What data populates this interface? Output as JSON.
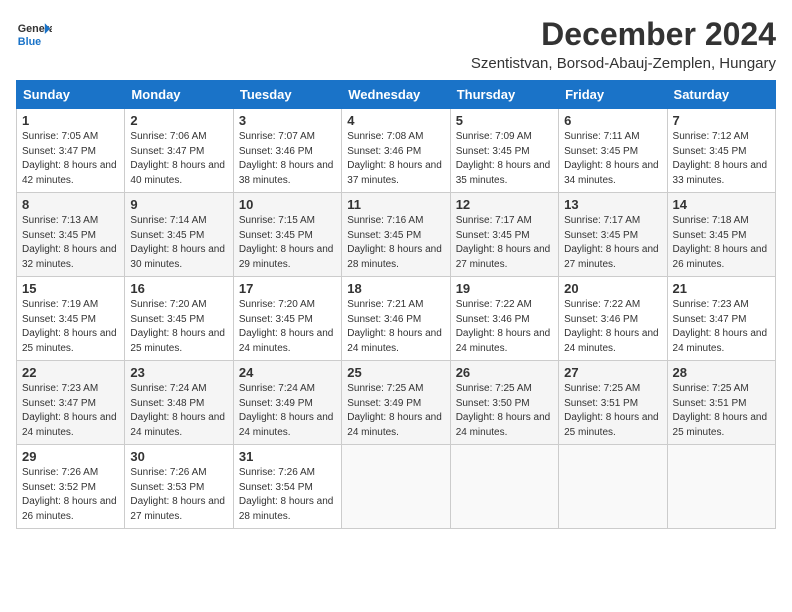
{
  "header": {
    "logo_line1": "General",
    "logo_line2": "Blue",
    "month_title": "December 2024",
    "location": "Szentistvan, Borsod-Abauj-Zemplen, Hungary"
  },
  "weekdays": [
    "Sunday",
    "Monday",
    "Tuesday",
    "Wednesday",
    "Thursday",
    "Friday",
    "Saturday"
  ],
  "weeks": [
    [
      {
        "day": "1",
        "sunrise": "Sunrise: 7:05 AM",
        "sunset": "Sunset: 3:47 PM",
        "daylight": "Daylight: 8 hours and 42 minutes."
      },
      {
        "day": "2",
        "sunrise": "Sunrise: 7:06 AM",
        "sunset": "Sunset: 3:47 PM",
        "daylight": "Daylight: 8 hours and 40 minutes."
      },
      {
        "day": "3",
        "sunrise": "Sunrise: 7:07 AM",
        "sunset": "Sunset: 3:46 PM",
        "daylight": "Daylight: 8 hours and 38 minutes."
      },
      {
        "day": "4",
        "sunrise": "Sunrise: 7:08 AM",
        "sunset": "Sunset: 3:46 PM",
        "daylight": "Daylight: 8 hours and 37 minutes."
      },
      {
        "day": "5",
        "sunrise": "Sunrise: 7:09 AM",
        "sunset": "Sunset: 3:45 PM",
        "daylight": "Daylight: 8 hours and 35 minutes."
      },
      {
        "day": "6",
        "sunrise": "Sunrise: 7:11 AM",
        "sunset": "Sunset: 3:45 PM",
        "daylight": "Daylight: 8 hours and 34 minutes."
      },
      {
        "day": "7",
        "sunrise": "Sunrise: 7:12 AM",
        "sunset": "Sunset: 3:45 PM",
        "daylight": "Daylight: 8 hours and 33 minutes."
      }
    ],
    [
      {
        "day": "8",
        "sunrise": "Sunrise: 7:13 AM",
        "sunset": "Sunset: 3:45 PM",
        "daylight": "Daylight: 8 hours and 32 minutes."
      },
      {
        "day": "9",
        "sunrise": "Sunrise: 7:14 AM",
        "sunset": "Sunset: 3:45 PM",
        "daylight": "Daylight: 8 hours and 30 minutes."
      },
      {
        "day": "10",
        "sunrise": "Sunrise: 7:15 AM",
        "sunset": "Sunset: 3:45 PM",
        "daylight": "Daylight: 8 hours and 29 minutes."
      },
      {
        "day": "11",
        "sunrise": "Sunrise: 7:16 AM",
        "sunset": "Sunset: 3:45 PM",
        "daylight": "Daylight: 8 hours and 28 minutes."
      },
      {
        "day": "12",
        "sunrise": "Sunrise: 7:17 AM",
        "sunset": "Sunset: 3:45 PM",
        "daylight": "Daylight: 8 hours and 27 minutes."
      },
      {
        "day": "13",
        "sunrise": "Sunrise: 7:17 AM",
        "sunset": "Sunset: 3:45 PM",
        "daylight": "Daylight: 8 hours and 27 minutes."
      },
      {
        "day": "14",
        "sunrise": "Sunrise: 7:18 AM",
        "sunset": "Sunset: 3:45 PM",
        "daylight": "Daylight: 8 hours and 26 minutes."
      }
    ],
    [
      {
        "day": "15",
        "sunrise": "Sunrise: 7:19 AM",
        "sunset": "Sunset: 3:45 PM",
        "daylight": "Daylight: 8 hours and 25 minutes."
      },
      {
        "day": "16",
        "sunrise": "Sunrise: 7:20 AM",
        "sunset": "Sunset: 3:45 PM",
        "daylight": "Daylight: 8 hours and 25 minutes."
      },
      {
        "day": "17",
        "sunrise": "Sunrise: 7:20 AM",
        "sunset": "Sunset: 3:45 PM",
        "daylight": "Daylight: 8 hours and 24 minutes."
      },
      {
        "day": "18",
        "sunrise": "Sunrise: 7:21 AM",
        "sunset": "Sunset: 3:46 PM",
        "daylight": "Daylight: 8 hours and 24 minutes."
      },
      {
        "day": "19",
        "sunrise": "Sunrise: 7:22 AM",
        "sunset": "Sunset: 3:46 PM",
        "daylight": "Daylight: 8 hours and 24 minutes."
      },
      {
        "day": "20",
        "sunrise": "Sunrise: 7:22 AM",
        "sunset": "Sunset: 3:46 PM",
        "daylight": "Daylight: 8 hours and 24 minutes."
      },
      {
        "day": "21",
        "sunrise": "Sunrise: 7:23 AM",
        "sunset": "Sunset: 3:47 PM",
        "daylight": "Daylight: 8 hours and 24 minutes."
      }
    ],
    [
      {
        "day": "22",
        "sunrise": "Sunrise: 7:23 AM",
        "sunset": "Sunset: 3:47 PM",
        "daylight": "Daylight: 8 hours and 24 minutes."
      },
      {
        "day": "23",
        "sunrise": "Sunrise: 7:24 AM",
        "sunset": "Sunset: 3:48 PM",
        "daylight": "Daylight: 8 hours and 24 minutes."
      },
      {
        "day": "24",
        "sunrise": "Sunrise: 7:24 AM",
        "sunset": "Sunset: 3:49 PM",
        "daylight": "Daylight: 8 hours and 24 minutes."
      },
      {
        "day": "25",
        "sunrise": "Sunrise: 7:25 AM",
        "sunset": "Sunset: 3:49 PM",
        "daylight": "Daylight: 8 hours and 24 minutes."
      },
      {
        "day": "26",
        "sunrise": "Sunrise: 7:25 AM",
        "sunset": "Sunset: 3:50 PM",
        "daylight": "Daylight: 8 hours and 24 minutes."
      },
      {
        "day": "27",
        "sunrise": "Sunrise: 7:25 AM",
        "sunset": "Sunset: 3:51 PM",
        "daylight": "Daylight: 8 hours and 25 minutes."
      },
      {
        "day": "28",
        "sunrise": "Sunrise: 7:25 AM",
        "sunset": "Sunset: 3:51 PM",
        "daylight": "Daylight: 8 hours and 25 minutes."
      }
    ],
    [
      {
        "day": "29",
        "sunrise": "Sunrise: 7:26 AM",
        "sunset": "Sunset: 3:52 PM",
        "daylight": "Daylight: 8 hours and 26 minutes."
      },
      {
        "day": "30",
        "sunrise": "Sunrise: 7:26 AM",
        "sunset": "Sunset: 3:53 PM",
        "daylight": "Daylight: 8 hours and 27 minutes."
      },
      {
        "day": "31",
        "sunrise": "Sunrise: 7:26 AM",
        "sunset": "Sunset: 3:54 PM",
        "daylight": "Daylight: 8 hours and 28 minutes."
      },
      null,
      null,
      null,
      null
    ]
  ]
}
